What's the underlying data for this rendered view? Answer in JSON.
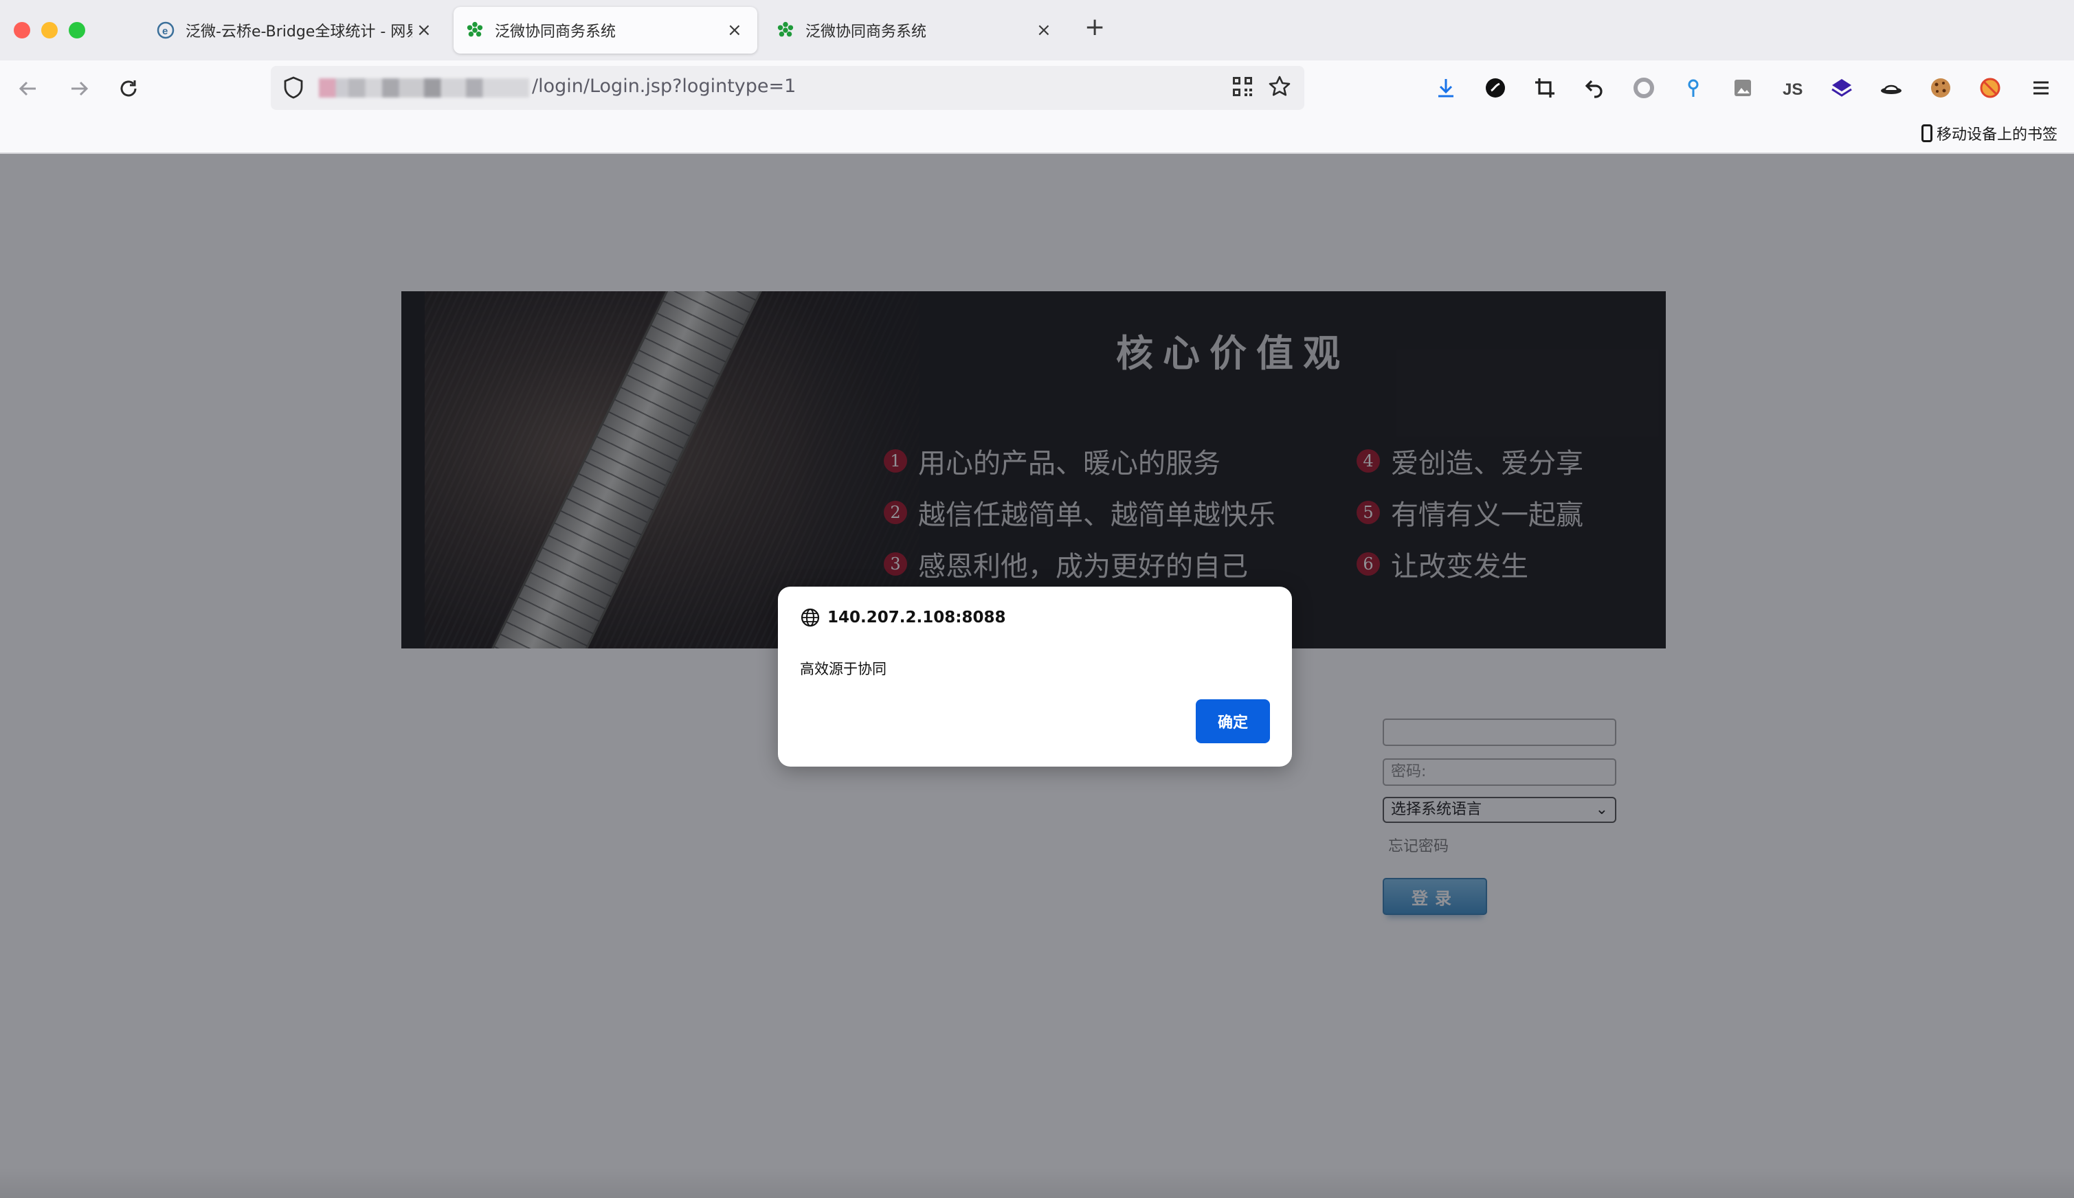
{
  "browser": {
    "tabs": [
      {
        "title": "泛微-云桥e-Bridge全球统计 - 网易",
        "close": "×"
      },
      {
        "title": "泛微协同商务系统",
        "close": "×"
      },
      {
        "title": "泛微协同商务系统",
        "close": "×"
      }
    ],
    "new_tab": "+",
    "url": "/login/Login.jsp?logintype=1",
    "bookmark_mobile": "移动设备上的书签"
  },
  "banner": {
    "title": "核心价值观",
    "values": [
      {
        "num": "1",
        "text": "用心的产品、暖心的服务"
      },
      {
        "num": "2",
        "text": "越信任越简单、越简单越快乐"
      },
      {
        "num": "3",
        "text": "感恩利他，成为更好的自己"
      },
      {
        "num": "4",
        "text": "爱创造、爱分享"
      },
      {
        "num": "5",
        "text": "有情有义一起赢"
      },
      {
        "num": "6",
        "text": "让改变发生"
      }
    ]
  },
  "login": {
    "password_placeholder": "密码:",
    "language_select": "选择系统语言",
    "forgot_password": "忘记密码",
    "login_button": "登录"
  },
  "dialog": {
    "host": "140.207.2.108:8088",
    "message": "高效源于协同",
    "ok_button": "确定"
  }
}
